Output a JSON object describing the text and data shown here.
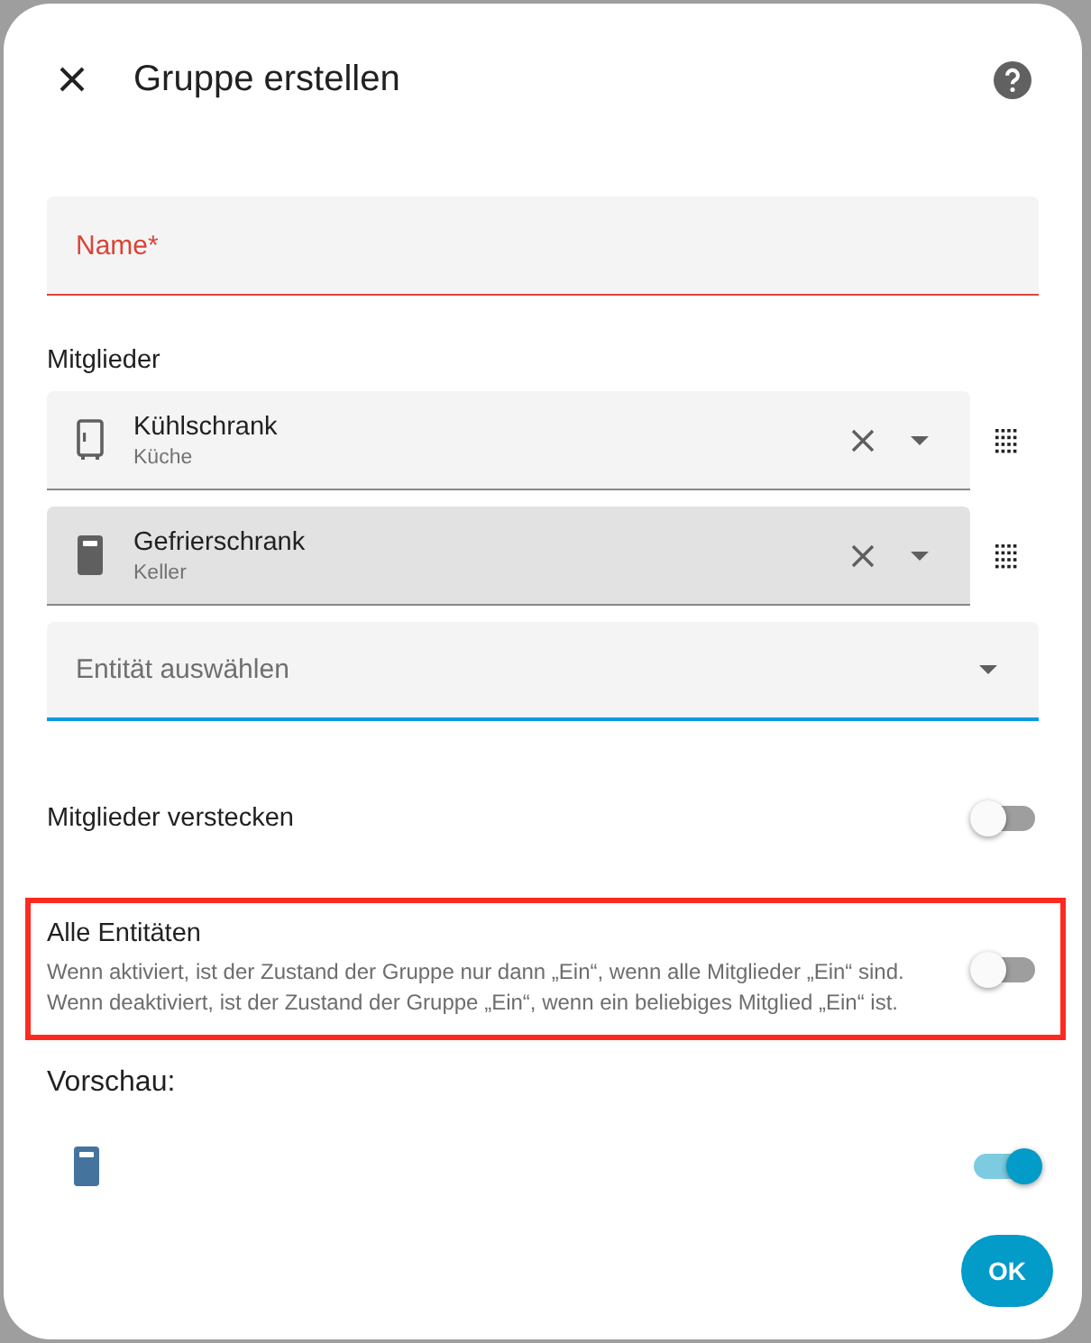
{
  "dialog": {
    "title": "Gruppe erstellen"
  },
  "name_field": {
    "label": "Name*",
    "required": true
  },
  "members_label": "Mitglieder",
  "members": [
    {
      "kind": "fridge",
      "name": "Kühlschrank",
      "area": "Küche",
      "highlighted": false
    },
    {
      "kind": "freezer",
      "name": "Gefrierschrank",
      "area": "Keller",
      "highlighted": true
    }
  ],
  "entity_picker": {
    "placeholder": "Entität auswählen"
  },
  "options": [
    {
      "title": "Mitglieder verstecken",
      "on": false,
      "highlighted": false
    },
    {
      "title": "Alle Entitäten",
      "description": "Wenn aktiviert, ist der Zustand der Gruppe nur dann „Ein“, wenn alle Mitglieder „Ein“ sind. Wenn deaktiviert, ist der Zustand der Gruppe „Ein“, wenn ein beliebiges Mitglied „Ein“ ist.",
      "on": false,
      "highlighted": true
    }
  ],
  "preview": {
    "label": "Vorschau:",
    "kind": "freezer",
    "on": true
  },
  "buttons": [
    "OK"
  ]
}
